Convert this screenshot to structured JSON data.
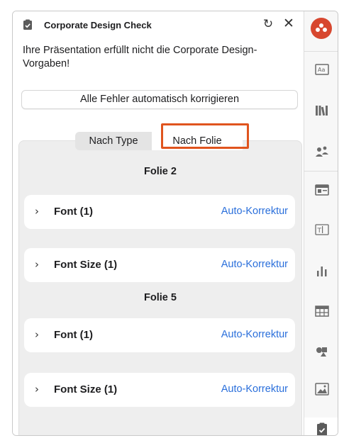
{
  "header": {
    "title": "Corporate Design Check",
    "refresh_icon": "↻",
    "close_icon": "✕"
  },
  "message": "Ihre Präsentation erfüllt nicht die Corporate Design-Vorgaben!",
  "fix_all_label": "Alle Fehler automatisch korrigieren",
  "tabs": {
    "by_type": "Nach Type",
    "by_slide": "Nach Folie",
    "active": "by_slide"
  },
  "groups": [
    {
      "title": "Folie 2",
      "items": [
        {
          "label": "Font (1)",
          "action": "Auto-Korrektur"
        },
        {
          "label": "Font Size (1)",
          "action": "Auto-Korrektur"
        }
      ]
    },
    {
      "title": "Folie 5",
      "items": [
        {
          "label": "Font (1)",
          "action": "Auto-Korrektur"
        },
        {
          "label": "Font Size (1)",
          "action": "Auto-Korrektur"
        }
      ]
    }
  ],
  "chevron": "›",
  "colors": {
    "accent_link": "#2a6fdb",
    "highlight_border": "#e0541e",
    "logo": "#d7472f"
  },
  "rail_icons": [
    "logo-icon",
    "text-style-icon",
    "library-icon",
    "people-icon",
    "layout-icon",
    "text-box-icon",
    "chart-icon",
    "table-icon",
    "shapes-icon",
    "image-icon",
    "design-check-icon"
  ]
}
